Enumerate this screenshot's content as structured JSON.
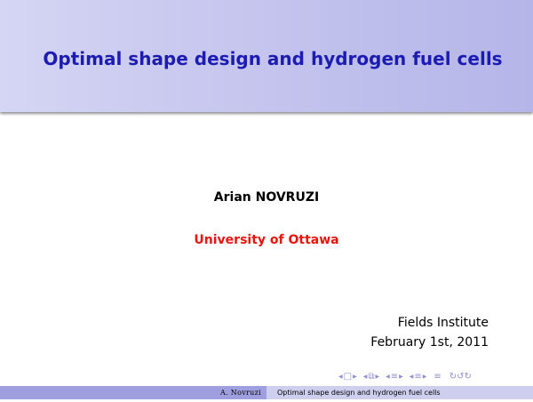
{
  "slide": {
    "title": "Optimal shape design and hydrogen fuel cells",
    "author": "Arian NOVRUZI",
    "institute": "University of Ottawa",
    "location": "Fields Institute",
    "date": "February 1st, 2011"
  },
  "footer": {
    "author": "A. Novruzi",
    "title": "Optimal shape design and hydrogen fuel cells"
  },
  "navigation": {
    "icons": [
      "nav-frame-icon",
      "nav-subsection-icon",
      "nav-section-icon",
      "nav-section-icon",
      "nav-menu-icon",
      "nav-search-icon"
    ],
    "color": "#8f8fcf"
  },
  "colors": {
    "title": "#1c1cb3",
    "institute": "#e8140d",
    "title_band": "#c4c4ee",
    "footer_left": "#9f9fe0",
    "footer_right": "#ceceef"
  }
}
